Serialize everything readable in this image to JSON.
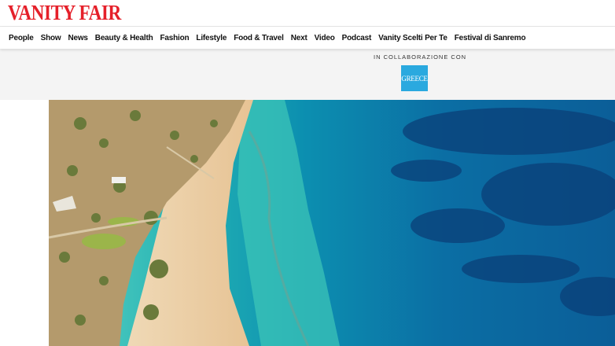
{
  "brand": {
    "logo_text": "VANITY FAIR",
    "color": "#e5202a"
  },
  "nav": {
    "items": [
      {
        "label": "People"
      },
      {
        "label": "Show"
      },
      {
        "label": "News"
      },
      {
        "label": "Beauty & Health"
      },
      {
        "label": "Fashion"
      },
      {
        "label": "Lifestyle"
      },
      {
        "label": "Food & Travel"
      },
      {
        "label": "Next"
      },
      {
        "label": "Video"
      },
      {
        "label": "Podcast"
      },
      {
        "label": "Vanity Scelti Per Te"
      },
      {
        "label": "Festival di Sanremo"
      }
    ]
  },
  "sponsor": {
    "label": "IN COLLABORAZIONE CON",
    "logo_text": "GREECE",
    "logo_color": "#2aa9df"
  },
  "hero": {
    "image_alt": "aerial-beach-photo"
  }
}
